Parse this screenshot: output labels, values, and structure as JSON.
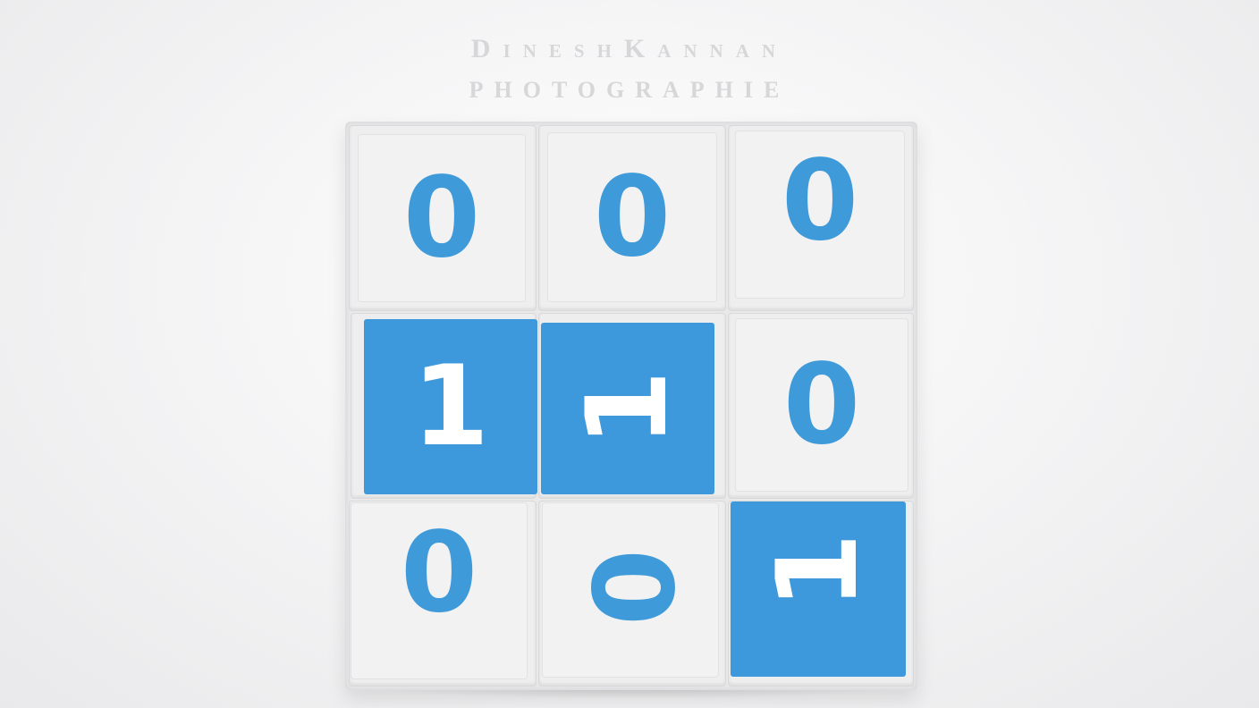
{
  "watermark": {
    "line1": "DineshKannan",
    "line2": "PHOTOGRAPHIE"
  },
  "colors": {
    "sticker_blue": "#3d98dc",
    "digit_blue": "#3f9ad9",
    "sticker_white": "#f2f2f3",
    "background": "#f5f5f6"
  },
  "cube_faces": [
    {
      "row": 1,
      "col": 1,
      "digit": "0",
      "sticker": "white",
      "rotation": "upright"
    },
    {
      "row": 1,
      "col": 2,
      "digit": "0",
      "sticker": "white",
      "rotation": "upright"
    },
    {
      "row": 1,
      "col": 3,
      "digit": "0",
      "sticker": "white",
      "rotation": "upright"
    },
    {
      "row": 2,
      "col": 1,
      "digit": "1",
      "sticker": "blue",
      "rotation": "upright"
    },
    {
      "row": 2,
      "col": 2,
      "digit": "1",
      "sticker": "blue",
      "rotation": "rotated-90"
    },
    {
      "row": 2,
      "col": 3,
      "digit": "0",
      "sticker": "white",
      "rotation": "upright"
    },
    {
      "row": 3,
      "col": 1,
      "digit": "0",
      "sticker": "white",
      "rotation": "upright"
    },
    {
      "row": 3,
      "col": 2,
      "digit": "0",
      "sticker": "white",
      "rotation": "rotated-90"
    },
    {
      "row": 3,
      "col": 3,
      "digit": "1",
      "sticker": "blue",
      "rotation": "rotated-90"
    }
  ]
}
